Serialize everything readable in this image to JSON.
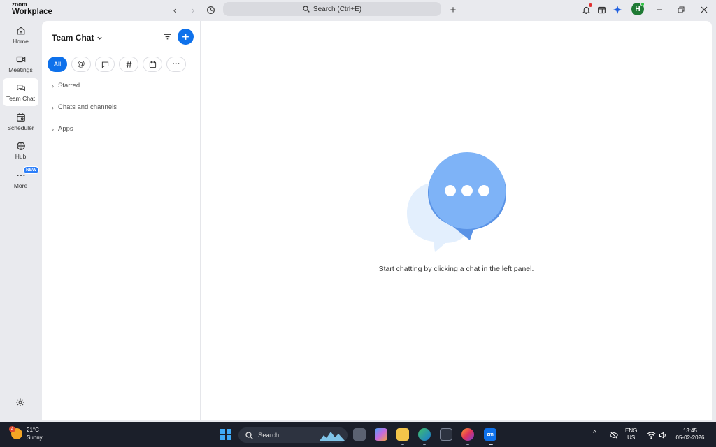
{
  "titlebar": {
    "brand_top": "zoom",
    "brand_bottom": "Workplace",
    "search_label": "Search (Ctrl+E)",
    "avatar_initial": "H"
  },
  "rail": {
    "items": [
      {
        "label": "Home",
        "icon": "home-icon"
      },
      {
        "label": "Meetings",
        "icon": "video-icon"
      },
      {
        "label": "Team Chat",
        "icon": "chat-icon",
        "active": true
      },
      {
        "label": "Scheduler",
        "icon": "calendar-icon"
      },
      {
        "label": "Hub",
        "icon": "globe-icon"
      },
      {
        "label": "More",
        "icon": "more-icon"
      }
    ],
    "new_badge": "NEW"
  },
  "left_panel": {
    "title": "Team Chat",
    "filters": [
      {
        "label": "All",
        "active": true
      },
      {
        "label": "@",
        "icon": "mention-icon"
      },
      {
        "label": "",
        "icon": "message-icon"
      },
      {
        "label": "",
        "icon": "hashtag-icon"
      },
      {
        "label": "",
        "icon": "calendar-icon"
      },
      {
        "label": "···",
        "icon": "more-icon"
      }
    ],
    "sections": [
      "Starred",
      "Chats and channels",
      "Apps"
    ]
  },
  "main": {
    "empty_message": "Start chatting by clicking a chat in the left panel."
  },
  "taskbar": {
    "weather_temp": "21°C",
    "weather_desc": "Sunny",
    "weather_badge": "4",
    "search_label": "Search",
    "lang_top": "ENG",
    "lang_bottom": "US",
    "time": "13:45",
    "date": "05-02-2026",
    "zoom_app_label": "zm"
  },
  "colors": {
    "accent": "#0e71eb",
    "bubble_front": "#7eb3f7",
    "bubble_back": "#e3effd",
    "taskbar": "#1b1f2a"
  }
}
